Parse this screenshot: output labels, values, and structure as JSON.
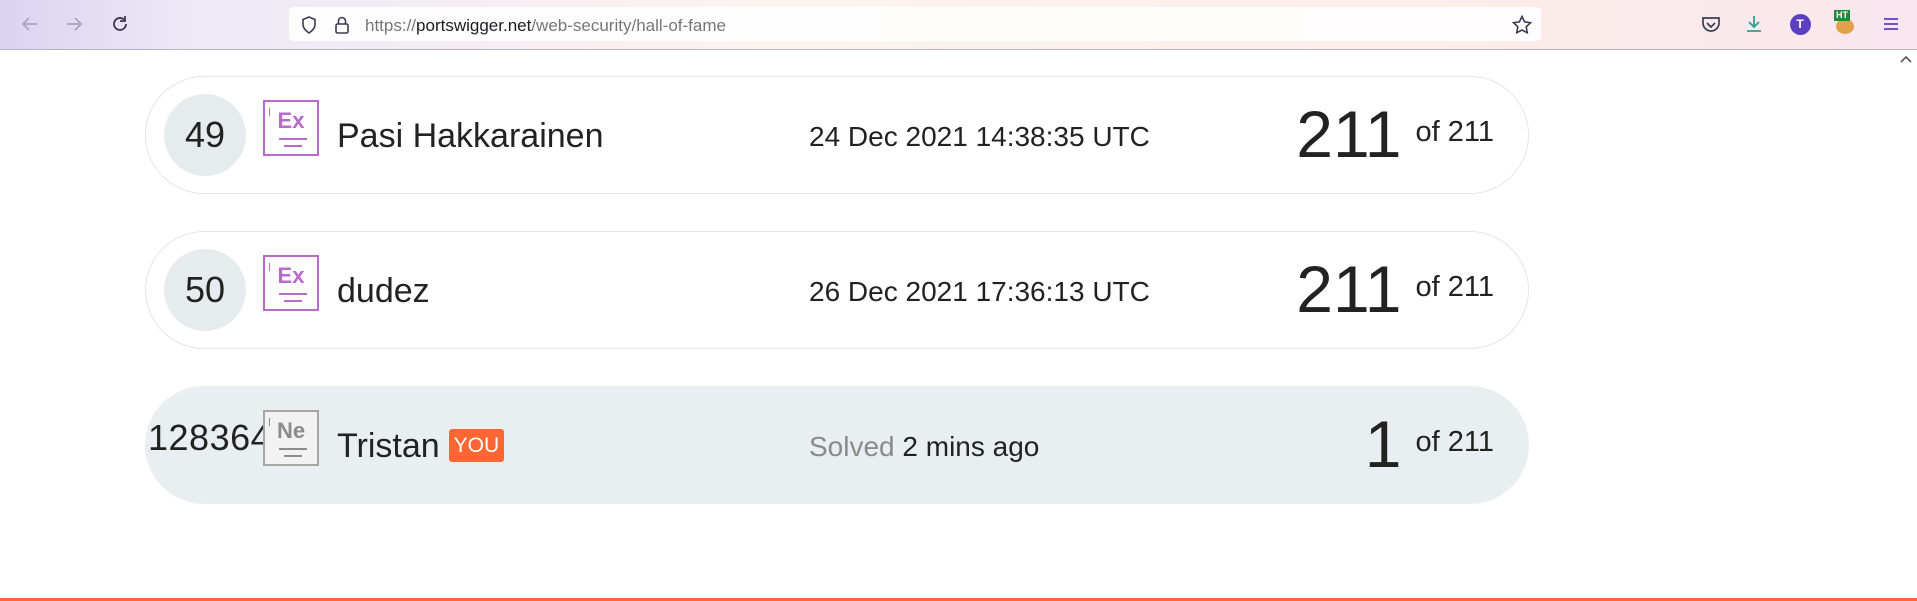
{
  "browser": {
    "url_host": "portswigger.net",
    "url_scheme": "https://",
    "url_path": "/web-security/hall-of-fame",
    "profile_initial": "T",
    "extension_label": "HT"
  },
  "leaderboard": [
    {
      "rank": "49",
      "element_symbol": "Ex",
      "name": "Pasi Hakkarainen",
      "time": "24 Dec 2021 14:38:35 UTC",
      "score": "211",
      "total": "of 211"
    },
    {
      "rank": "50",
      "element_symbol": "Ex",
      "name": "dudez",
      "time": "26 Dec 2021 17:36:13 UTC",
      "score": "211",
      "total": "of 211"
    }
  ],
  "current_user": {
    "rank": "128364",
    "element_symbol": "Ne",
    "name": "Tristan",
    "you_badge": "YOU",
    "solved_label": "Solved",
    "solved_ago": "2 mins ago",
    "score": "1",
    "total": "of 211"
  },
  "colors": {
    "accent": "#ff6633",
    "expert_badge": "#b86bc8",
    "newcomer_badge": "#a7a7a7",
    "highlight_row": "#e9eef1"
  }
}
